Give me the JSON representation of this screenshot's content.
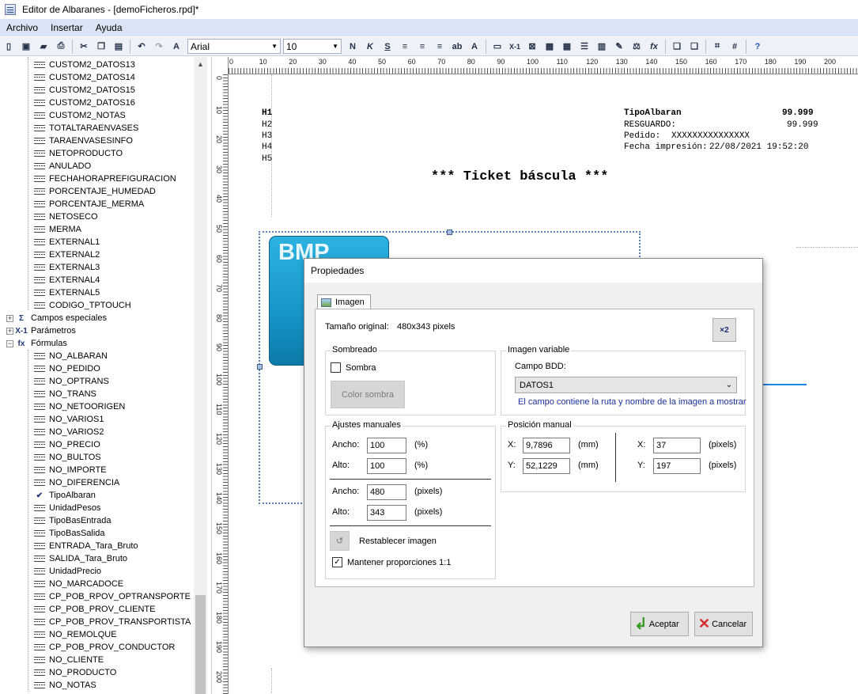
{
  "window": {
    "title": "Editor de Albaranes - [demoFicheros.rpd]*"
  },
  "menu": [
    "Archivo",
    "Insertar",
    "Ayuda"
  ],
  "toolbar": {
    "font_name": "Arial",
    "font_size": "10",
    "bold_label": "N",
    "italic_label": "K",
    "underline_label": "S",
    "fx_label": "fx",
    "x1_label": "X-1"
  },
  "tree": {
    "fields_top": [
      "CUSTOM2_DATOS13",
      "CUSTOM2_DATOS14",
      "CUSTOM2_DATOS15",
      "CUSTOM2_DATOS16",
      "CUSTOM2_NOTAS",
      "TOTALTARAENVASES",
      "TARAENVASESINFO",
      "NETOPRODUCTO",
      "ANULADO",
      "FECHAHORAPREFIGURACION",
      "PORCENTAJE_HUMEDAD",
      "PORCENTAJE_MERMA",
      "NETOSECO",
      "MERMA",
      "EXTERNAL1",
      "EXTERNAL2",
      "EXTERNAL3",
      "EXTERNAL4",
      "EXTERNAL5",
      "CODIGO_TPTOUCH"
    ],
    "groups": [
      "Campos especiales",
      "Parámetros",
      "Fórmulas"
    ],
    "formulas": [
      "NO_ALBARAN",
      "NO_PEDIDO",
      "NO_OPTRANS",
      "NO_TRANS",
      "NO_NETOORIGEN",
      "NO_VARIOS1",
      "NO_VARIOS2",
      "NO_PRECIO",
      "NO_BULTOS",
      "NO_IMPORTE",
      "NO_DIFERENCIA",
      "TipoAlbaran",
      "UnidadPesos",
      "TipoBasEntrada",
      "TipoBasSalida",
      "ENTRADA_Tara_Bruto",
      "SALIDA_Tara_Bruto",
      "UnidadPrecio",
      "NO_MARCADOCE",
      "CP_POB_RPOV_OPTRANSPORTE",
      "CP_POB_PROV_CLIENTE",
      "CP_POB_PROV_TRANSPORTISTA",
      "NO_REMOLQUE",
      "CP_POB_PROV_CONDUCTOR",
      "NO_CLIENTE",
      "NO_PRODUCTO",
      "NO_NOTAS"
    ]
  },
  "rulers": {
    "h": [
      "0",
      "10",
      "20",
      "30",
      "40",
      "50",
      "60",
      "70",
      "80",
      "90",
      "100",
      "110",
      "120",
      "130",
      "140",
      "150",
      "160",
      "170",
      "180",
      "190",
      "200"
    ],
    "v": [
      "0",
      "10",
      "20",
      "30",
      "40",
      "50",
      "60",
      "70",
      "80",
      "90",
      "100",
      "110",
      "120",
      "130",
      "140",
      "150",
      "160",
      "170",
      "180",
      "190",
      "200"
    ]
  },
  "canvas": {
    "h_lines": [
      "H1",
      "H2",
      "H3",
      "H4",
      "H5"
    ],
    "tipo_albaran": "TipoAlbaran",
    "tipo_value": "99.999",
    "resguardo": "RESGUARDO:",
    "resguardo_value": "99.999",
    "pedido": "Pedido:",
    "pedido_value": "XXXXXXXXXXXXXXX",
    "fecha": "Fecha impresión:",
    "fecha_value": "22/08/2021 19:52:20",
    "ticket_title": "*** Ticket báscula ***",
    "bmp_label": "BMP"
  },
  "dialog": {
    "title": "Propiedades",
    "tab": "Imagen",
    "original_size_label": "Tamaño original:",
    "original_size_value": "480x343 pixels",
    "x2_button": "×2",
    "sombreado": {
      "title": "Sombreado",
      "sombra_label": "Sombra",
      "sombra_checked": false,
      "color_button": "Color sombra"
    },
    "imagen_variable": {
      "title": "Imagen variable",
      "campo_label": "Campo BDD:",
      "campo_value": "DATOS1",
      "hint": "El campo contiene la ruta y nombre de la imagen a mostrar"
    },
    "ajustes": {
      "title": "Ajustes manuales",
      "ancho_label": "Ancho:",
      "alto_label": "Alto:",
      "ancho_pct": "100",
      "alto_pct": "100",
      "pct_unit": "(%)",
      "ancho_px": "480",
      "alto_px": "343",
      "px_unit": "(pixels)",
      "restablecer": "Restablecer imagen",
      "mantener": "Mantener proporciones 1:1",
      "mantener_checked": true
    },
    "posicion": {
      "title": "Posición manual",
      "x_label": "X:",
      "y_label": "Y:",
      "x_mm": "9,7896",
      "y_mm": "52,1229",
      "mm_unit": "(mm)",
      "x_px": "37",
      "y_px": "197",
      "px_unit": "(pixels)"
    },
    "accept": "Aceptar",
    "cancel": "Cancelar"
  },
  "colors": {
    "accent_arrow": "#1e88e5",
    "menubar": "#dbe4f4",
    "hint_text": "#1a2fa0"
  }
}
